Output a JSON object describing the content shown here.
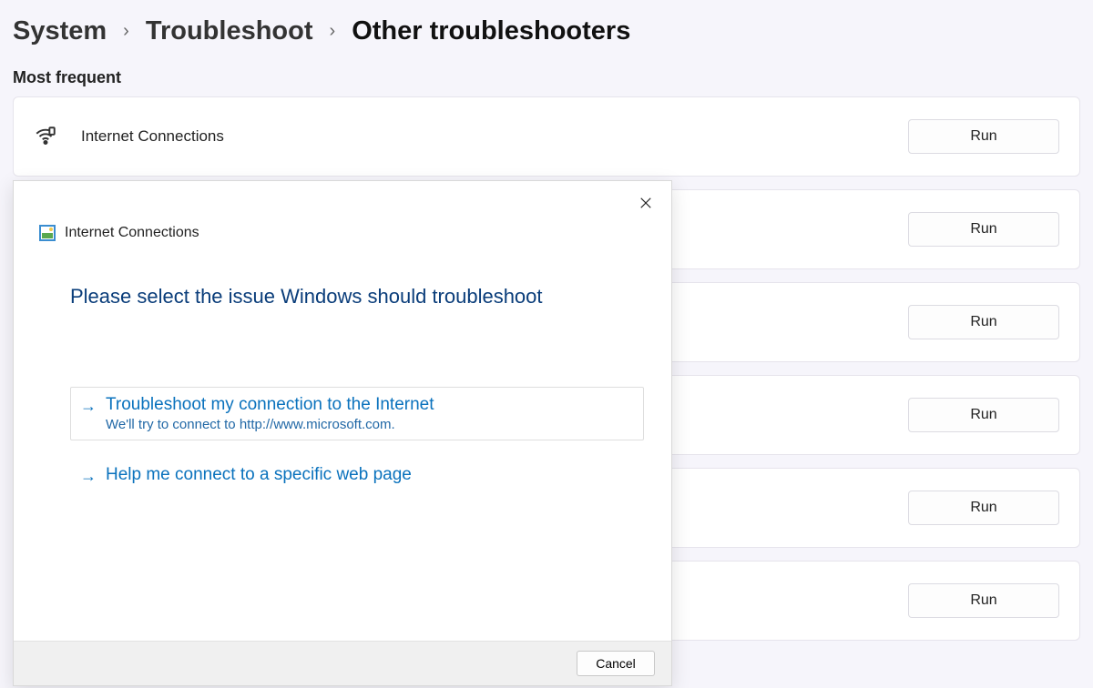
{
  "breadcrumb": {
    "system": "System",
    "troubleshoot": "Troubleshoot",
    "current": "Other troubleshooters"
  },
  "section_heading": "Most frequent",
  "troubleshooters": [
    {
      "label": "Internet Connections",
      "run": "Run"
    },
    {
      "label": "",
      "run": "Run"
    },
    {
      "label": "",
      "run": "Run"
    },
    {
      "label": "",
      "run": "Run"
    },
    {
      "label": "",
      "run": "Run"
    },
    {
      "label": "",
      "run": "Run"
    }
  ],
  "dialog": {
    "header": "Internet Connections",
    "title": "Please select the issue Windows should troubleshoot",
    "options": [
      {
        "title": "Troubleshoot my connection to the Internet",
        "sub": "We'll try to connect to http://www.microsoft.com."
      },
      {
        "title": "Help me connect to a specific web page",
        "sub": ""
      }
    ],
    "cancel": "Cancel"
  }
}
